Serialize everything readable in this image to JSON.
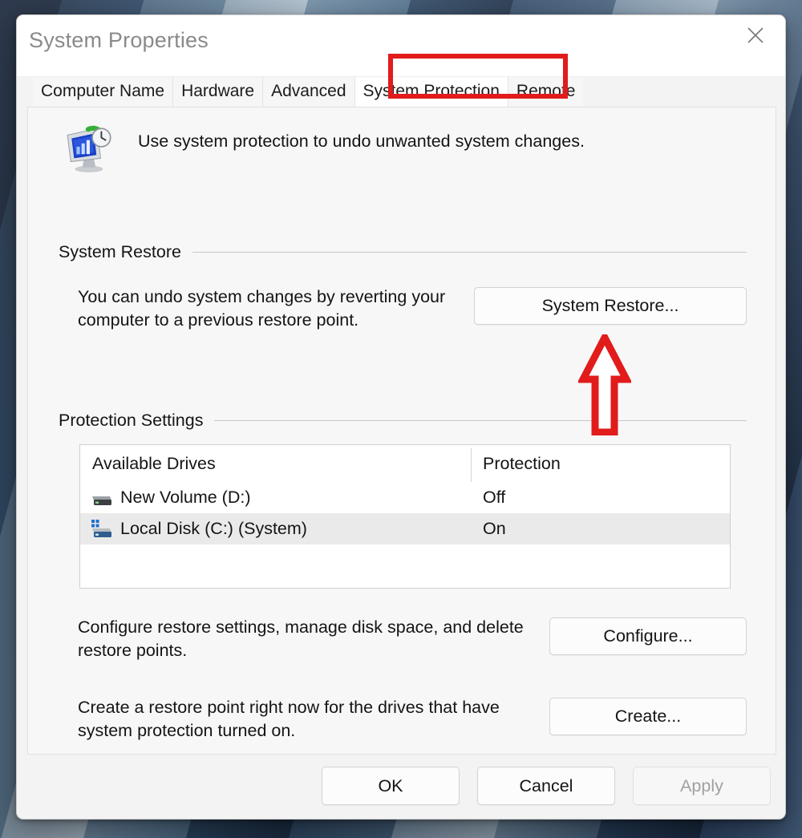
{
  "window": {
    "title": "System Properties",
    "close_icon": "close-icon"
  },
  "tabs": [
    {
      "label": "Computer Name",
      "active": false
    },
    {
      "label": "Hardware",
      "active": false
    },
    {
      "label": "Advanced",
      "active": false
    },
    {
      "label": "System Protection",
      "active": true
    },
    {
      "label": "Remote",
      "active": false
    }
  ],
  "intro": {
    "icon": "system-protection-icon",
    "text": "Use system protection to undo unwanted system changes."
  },
  "system_restore": {
    "group_label": "System Restore",
    "description": "You can undo system changes by reverting your computer to a previous restore point.",
    "button_label": "System Restore..."
  },
  "protection_settings": {
    "group_label": "Protection Settings",
    "columns": [
      "Available Drives",
      "Protection"
    ],
    "rows": [
      {
        "icon": "hard-disk-icon",
        "drive": "New Volume (D:)",
        "protection": "Off",
        "selected": false
      },
      {
        "icon": "system-disk-icon",
        "drive": "Local Disk (C:) (System)",
        "protection": "On",
        "selected": true
      }
    ]
  },
  "configure": {
    "description": "Configure restore settings, manage disk space, and delete restore points.",
    "button_label": "Configure..."
  },
  "create": {
    "description": "Create a restore point right now for the drives that have system protection turned on.",
    "button_label": "Create..."
  },
  "footer": {
    "ok_label": "OK",
    "cancel_label": "Cancel",
    "apply_label": "Apply",
    "apply_disabled": true
  },
  "annotations": {
    "highlight_color": "#e21b1b",
    "arrow_color": "#e21b1b",
    "arrow_target": "System Restore...",
    "highlight_target": "System Protection"
  }
}
